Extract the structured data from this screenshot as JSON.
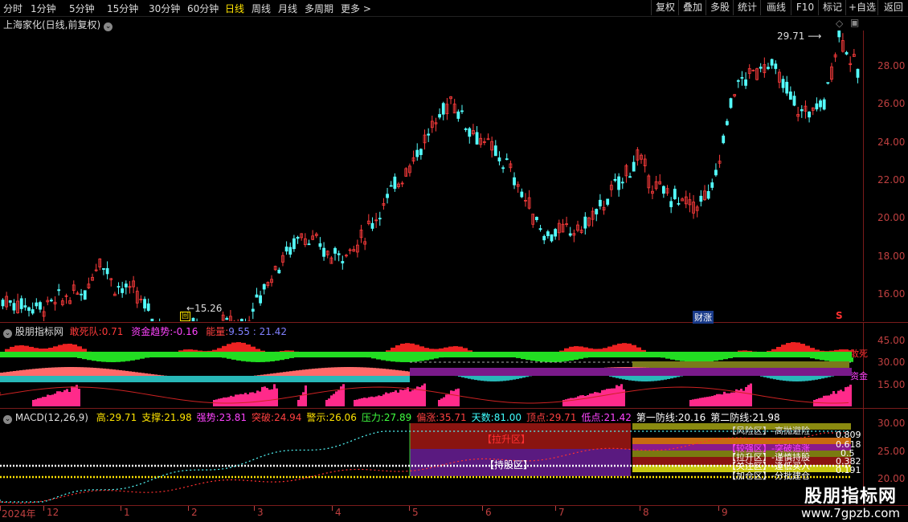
{
  "toolbar": {
    "timeframes": [
      "分时",
      "1分钟",
      "5分钟",
      "15分钟",
      "30分钟",
      "60分钟",
      "日线",
      "周线",
      "月线",
      "多周期",
      "更多 >"
    ],
    "active": "日线",
    "buttons": [
      "复权",
      "叠加",
      "多股",
      "统计",
      "画线",
      "F10",
      "标记",
      "+自选",
      "返回"
    ]
  },
  "main_chart": {
    "title": "上海家化(日线,前复权)",
    "high_label": "29.71",
    "low_label": "15.26",
    "price_ticks": [
      "28.00",
      "26.00",
      "24.00",
      "22.00",
      "20.00",
      "18.00",
      "16.00"
    ],
    "markers": {
      "caizhang": "财涨",
      "s": "S",
      "square": "回"
    }
  },
  "indicator1": {
    "name": "股朋指标网",
    "items": [
      {
        "label": "敢死队:",
        "value": "0.71",
        "color": "#ff3a3a"
      },
      {
        "label": "资金趋势:",
        "value": "-0.16",
        "color": "#ff44ff"
      },
      {
        "label": "能量:",
        "value": "9.55 : 21.42",
        "color": "#ff4040"
      }
    ],
    "ticks": [
      "45.00",
      "30.00",
      "15.00"
    ],
    "side_labels": [
      "敢死",
      "资金"
    ]
  },
  "indicator2": {
    "name": "MACD(12,26,9)",
    "items": [
      {
        "label": "高:",
        "value": "29.71",
        "color": "#ffe400"
      },
      {
        "label": "支撑:",
        "value": "21.98",
        "color": "#ffe400"
      },
      {
        "label": "强势:",
        "value": "23.81",
        "color": "#ff44ff"
      },
      {
        "label": "突破:",
        "value": "24.94",
        "color": "#ff4040"
      },
      {
        "label": "警示:",
        "value": "26.06",
        "color": "#ffe400"
      },
      {
        "label": "压力:",
        "value": "27.89",
        "color": "#40ff40"
      },
      {
        "label": "偏涨:",
        "value": "35.71",
        "color": "#ff4040"
      },
      {
        "label": "天数:",
        "value": "81.00",
        "color": "#40ffff"
      },
      {
        "label": "顶点:",
        "value": "29.71",
        "color": "#ff4040"
      },
      {
        "label": "低点:",
        "value": "21.42",
        "color": "#ff44ff"
      },
      {
        "label": "第一防线:",
        "value": "20.16",
        "color": "#ffffff"
      },
      {
        "label": "第二防线:",
        "value": "21.98",
        "color": "#ffffff"
      }
    ],
    "ticks": [
      "30.00",
      "25.00",
      "20.00"
    ],
    "zones": [
      "【拉升区】",
      "【持股区】",
      "【风险区】-高抛避险",
      "【较强区】-突破追涨",
      "【拉升区】-谨慎持股",
      "【关注区】-逢低买入",
      "【加仓区】-分批建仓"
    ],
    "zone_values": [
      "0.809",
      "0.618",
      "0.5",
      "0.382",
      "0.191"
    ]
  },
  "date_axis": [
    "2024年",
    "12",
    "1",
    "2",
    "3",
    "4",
    "5",
    "6",
    "7",
    "8",
    "9"
  ],
  "watermark": {
    "line1": "股朋指标网",
    "line2": "www.7gpzb.com"
  }
}
